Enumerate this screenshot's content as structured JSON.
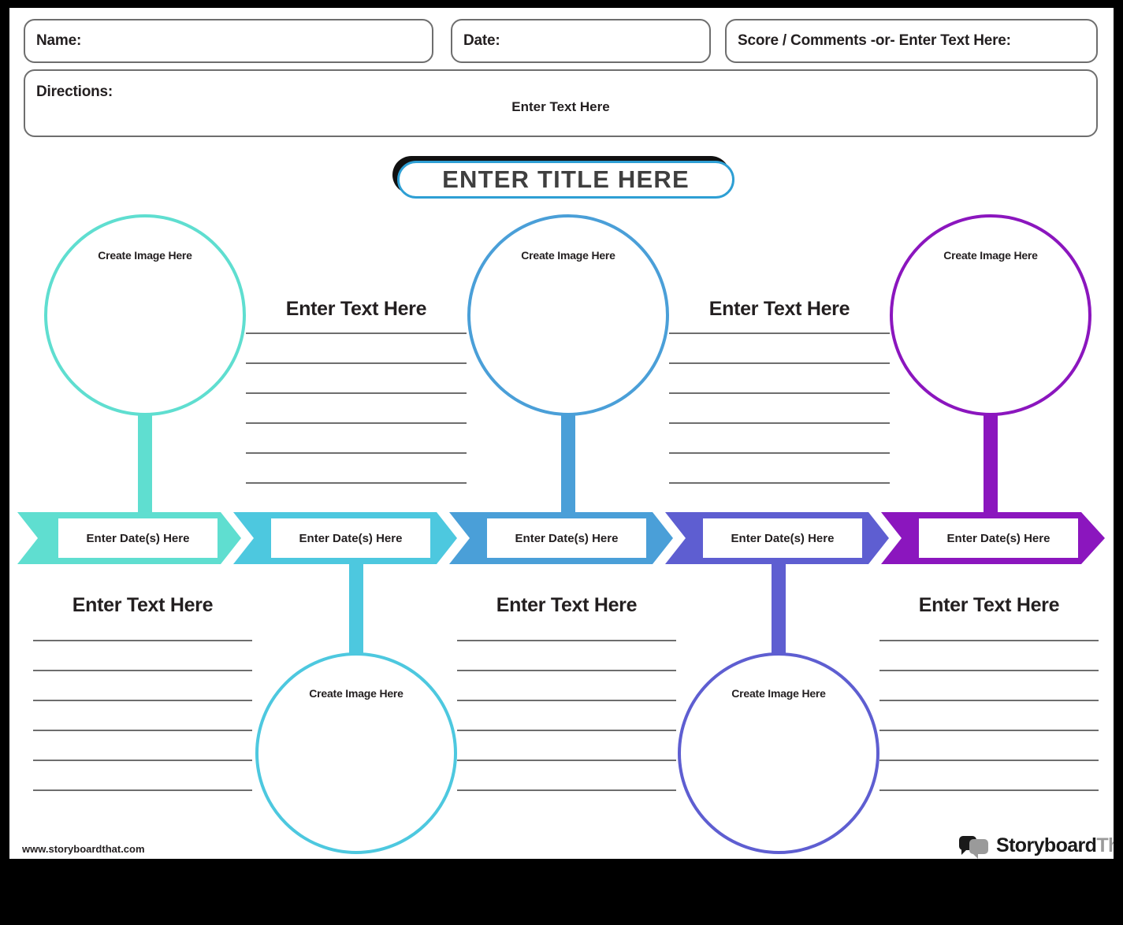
{
  "header": {
    "name_label": "Name:",
    "date_label": "Date:",
    "score_label": "Score / Comments -or- Enter Text Here:",
    "directions_label": "Directions:",
    "directions_placeholder": "Enter Text Here"
  },
  "title": {
    "text": "ENTER TITLE HERE",
    "border_color": "#2e9fd4",
    "shadow_color": "#111111"
  },
  "labels": {
    "create_image": "Create Image Here",
    "enter_text": "Enter Text Here",
    "enter_dates": "Enter Date(s) Here"
  },
  "palette": {
    "step1": "#5fded0",
    "step2": "#4dc8df",
    "step3": "#4a9fd8",
    "step4": "#5e5ed1",
    "step5": "#8b16be"
  },
  "timeline": {
    "steps": [
      {
        "index": 1,
        "color": "#5fded0",
        "circle_position": "top",
        "circle_label": "Create Image Here",
        "date_label": "Enter Date(s) Here",
        "text_position": "bottom",
        "text_label": "Enter Text Here",
        "line_count": 6
      },
      {
        "index": 2,
        "color": "#4dc8df",
        "circle_position": "bottom",
        "circle_label": "Create Image Here",
        "date_label": "Enter Date(s) Here",
        "text_position": "top",
        "text_label": "Enter Text Here",
        "line_count": 6
      },
      {
        "index": 3,
        "color": "#4a9fd8",
        "circle_position": "top",
        "circle_label": "Create Image Here",
        "date_label": "Enter Date(s) Here",
        "text_position": "bottom",
        "text_label": "Enter Text Here",
        "line_count": 6
      },
      {
        "index": 4,
        "color": "#5e5ed1",
        "circle_position": "bottom",
        "circle_label": "Create Image Here",
        "date_label": "Enter Date(s) Here",
        "text_position": "top",
        "text_label": "Enter Text Here",
        "line_count": 6
      },
      {
        "index": 5,
        "color": "#8b16be",
        "circle_position": "top",
        "circle_label": "Create Image Here",
        "date_label": "Enter Date(s) Here",
        "text_position": "bottom",
        "text_label": "Enter Text Here",
        "line_count": 6
      }
    ]
  },
  "footer": {
    "url": "www.storyboardthat.com",
    "logo_primary": "Storyboard",
    "logo_secondary": "That"
  }
}
